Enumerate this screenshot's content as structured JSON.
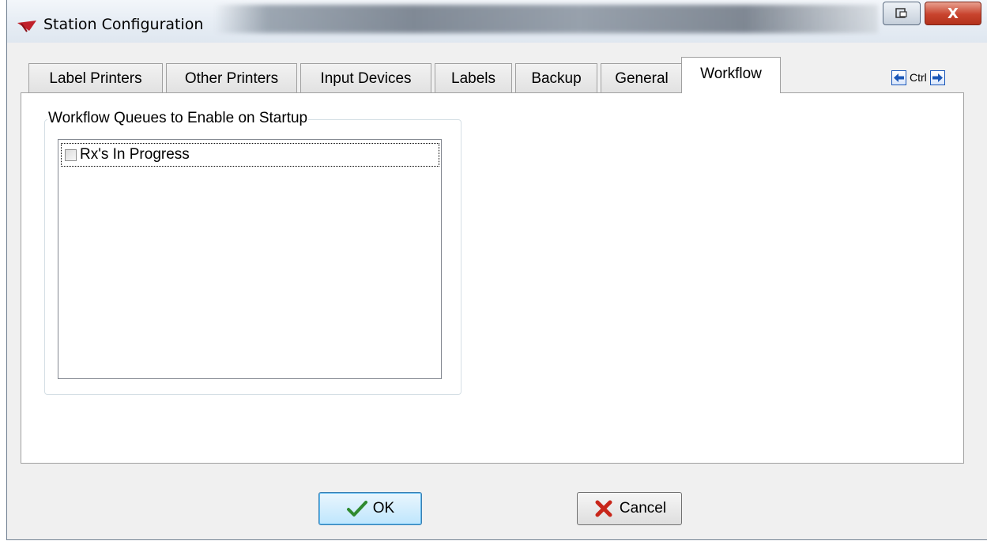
{
  "window": {
    "title": "Station Configuration",
    "close_glyph": "X"
  },
  "tabs": [
    {
      "label": "Label Printers"
    },
    {
      "label": "Other Printers"
    },
    {
      "label": "Input Devices"
    },
    {
      "label": "Labels"
    },
    {
      "label": "Backup"
    },
    {
      "label": "General"
    },
    {
      "label": "Workflow"
    }
  ],
  "active_tab": "Workflow",
  "tab_nav": {
    "label": "Ctrl",
    "prev_icon": "arrow-left-icon",
    "next_icon": "arrow-right-icon"
  },
  "workflow": {
    "group_title": "Workflow Queues to Enable on Startup",
    "queues": [
      {
        "label": "Rx's In Progress",
        "checked": false
      }
    ]
  },
  "buttons": {
    "ok_label": "OK",
    "cancel_label": "Cancel"
  },
  "colors": {
    "ok_check": "#2f8a2f",
    "cancel_x": "#c8261a",
    "nav_arrow": "#1a57b8",
    "app_icon": "#c0202a"
  }
}
